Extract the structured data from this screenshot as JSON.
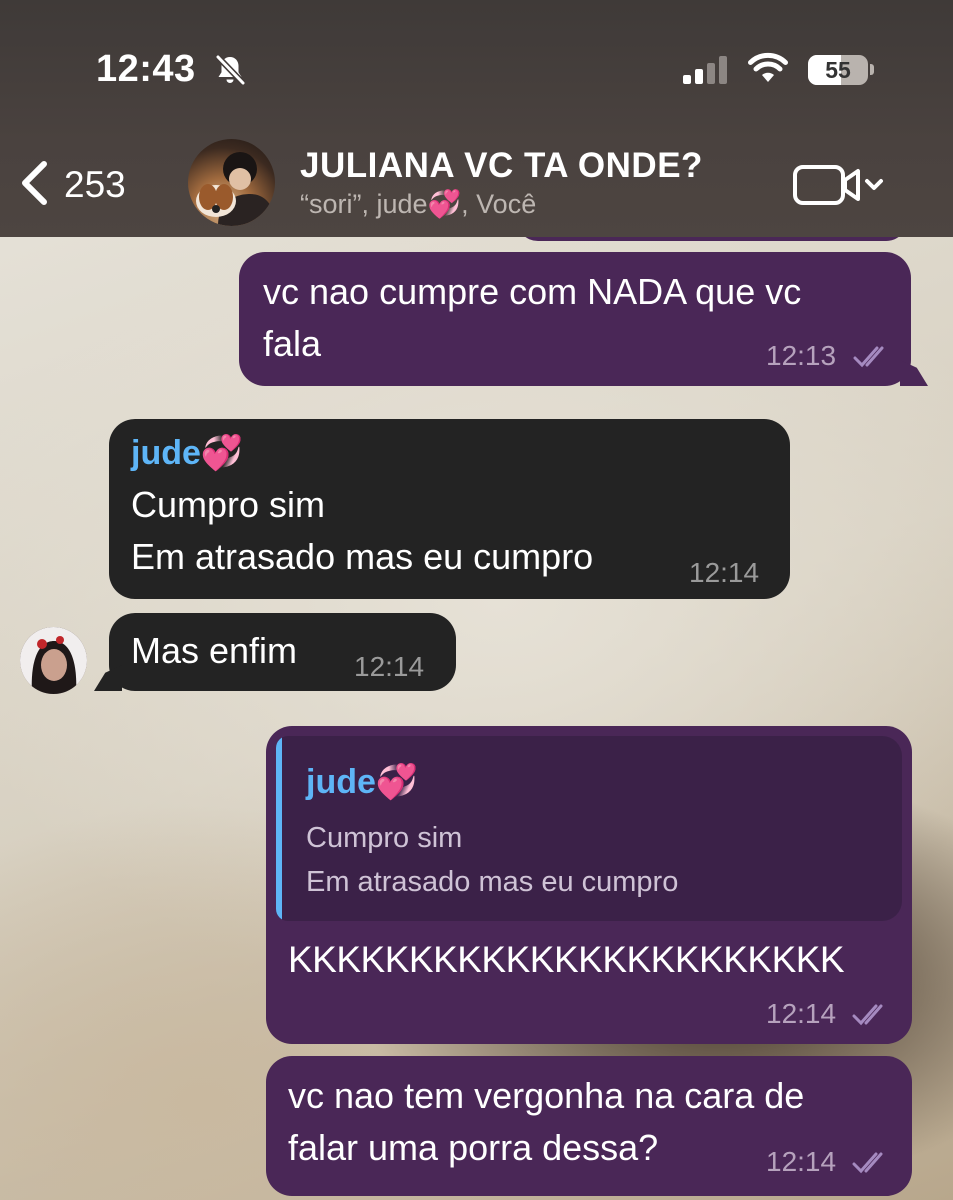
{
  "status_bar": {
    "time": "12:43",
    "battery": "55",
    "battery_level": 0.55
  },
  "header": {
    "back_count": "253",
    "title": "JULIANA VC TA ONDE?",
    "subtitle": "“sori”, jude💞, Você"
  },
  "colors": {
    "outgoing_bubble": "#4a2757",
    "incoming_bubble": "#232323",
    "sender_name": "#5eb5f7",
    "read_check": "#a58ac0"
  },
  "icons": {
    "back": "chevron-left-icon",
    "bell": "bell-slash-icon",
    "video": "video-camera-icon",
    "read": "double-check-icon"
  },
  "messages": [
    {
      "id": "m1",
      "direction": "out",
      "text": "vc nao cumpre com NADA que vc\nfala",
      "time": "12:13"
    },
    {
      "id": "m2",
      "direction": "in",
      "sender": "jude💞",
      "text": "Cumpro sim\nEm atrasado mas eu cumpro",
      "time": "12:14"
    },
    {
      "id": "m3",
      "direction": "in",
      "text": "Mas enfim",
      "time": "12:14"
    },
    {
      "id": "m4",
      "direction": "out",
      "reply_to": {
        "sender": "jude💞",
        "text": "Cumpro sim\nEm atrasado mas eu cumpro"
      },
      "text": "KKKKKKKKKKKKKKKKKKKKKKK",
      "time": "12:14"
    },
    {
      "id": "m5",
      "direction": "out",
      "text": "vc nao tem vergonha na cara de\nfalar uma porra dessa?",
      "time": "12:14"
    }
  ]
}
